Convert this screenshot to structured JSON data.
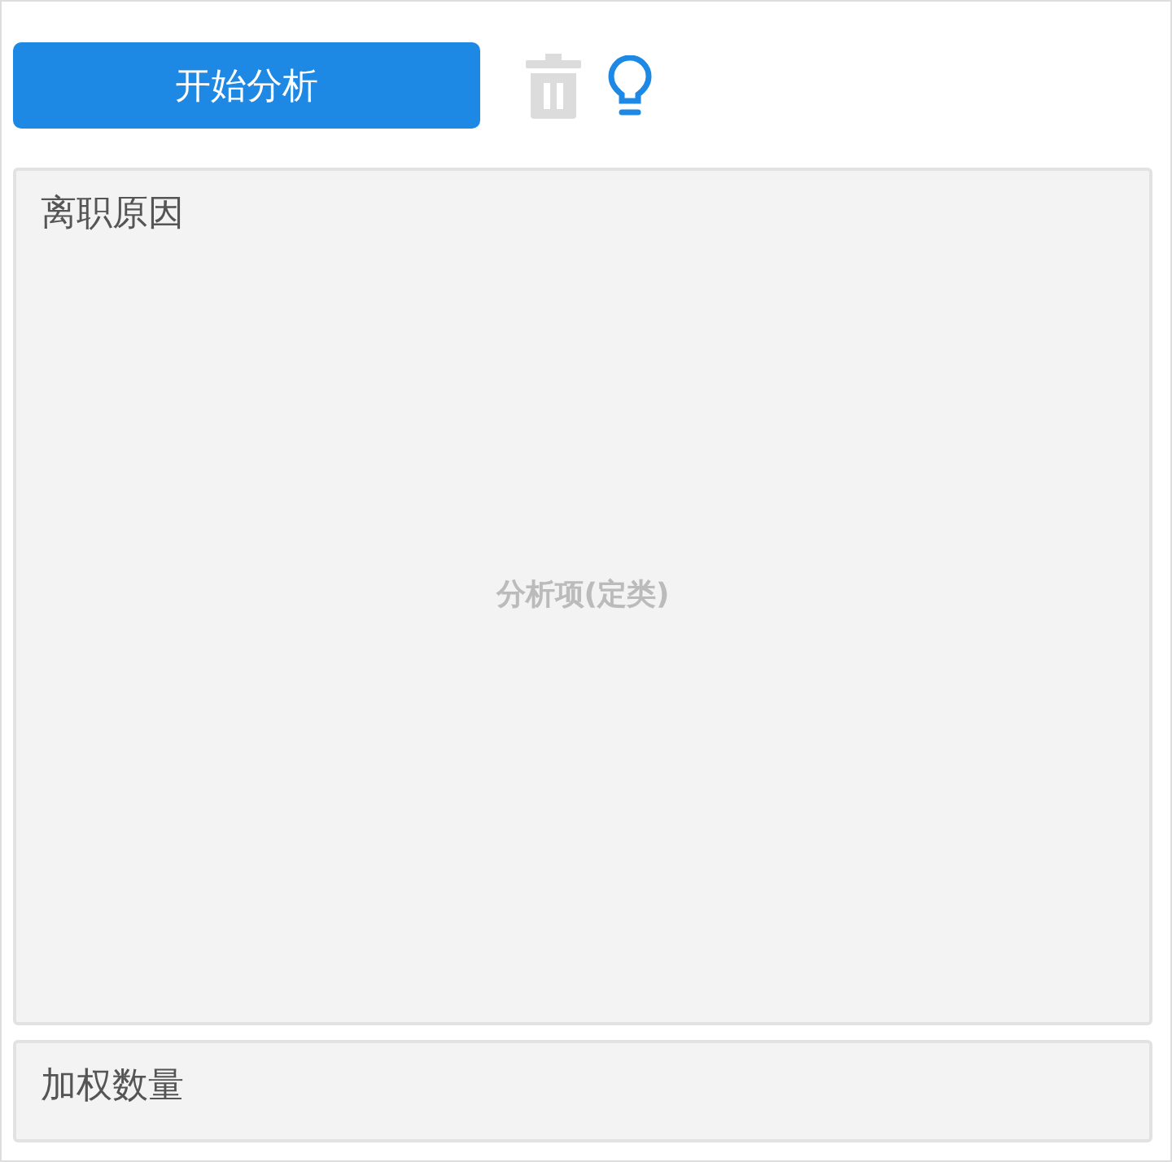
{
  "toolbar": {
    "start_button": "开始分析",
    "delete_disabled": true
  },
  "drop_zones": [
    {
      "kind": "large",
      "title": "离职原因",
      "placeholder": "分析项(定类)"
    },
    {
      "kind": "small",
      "title": "加权数量"
    }
  ]
}
